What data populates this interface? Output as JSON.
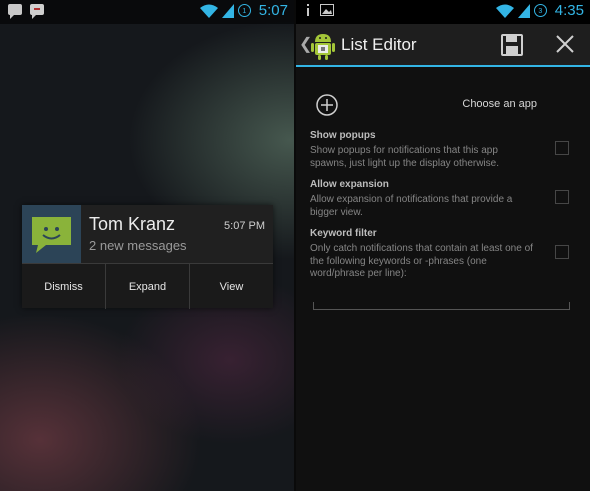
{
  "left": {
    "status_bar": {
      "time": "5:07",
      "sync_badge": "1"
    },
    "notification": {
      "title": "Tom Kranz",
      "subtitle": "2 new messages",
      "time": "5:07 PM",
      "icon": "sms-smiley-icon",
      "actions": [
        "Dismiss",
        "Expand",
        "View"
      ]
    }
  },
  "right": {
    "status_bar": {
      "time": "4:35",
      "sync_badge": "3"
    },
    "action_bar": {
      "title": "List Editor"
    },
    "choose_app_label": "Choose an app",
    "options": [
      {
        "title": "Show popups",
        "description": "Show popups for notifications that this app spawns, just light up the display otherwise."
      },
      {
        "title": "Allow expansion",
        "description": "Allow expansion of notifications that provide a bigger view."
      },
      {
        "title": "Keyword filter",
        "description": "Only catch notifications that contain at least one of the following keywords or -phrases (one word/phrase per line):"
      }
    ]
  },
  "colors": {
    "accent": "#33b5e5",
    "sms_green": "#8ab33a",
    "android_green": "#a4c639"
  }
}
